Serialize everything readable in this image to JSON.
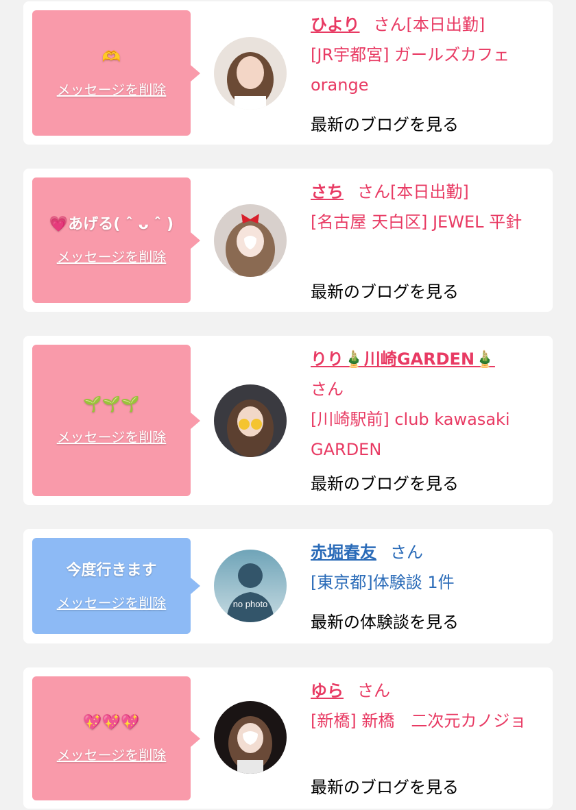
{
  "cards": [
    {
      "message": "🫶",
      "delete_label": "メッセージを削除",
      "name": "ひより",
      "honorific": "さん",
      "status": "[本日出勤]",
      "shop": "[JR宇都宮] ガールズカフェorange",
      "link_label": "最新のブログを見る",
      "avatar_icon": "photo-girl-1"
    },
    {
      "message": "💗あげる( ˆ ᴗ ˆ )",
      "delete_label": "メッセージを削除",
      "name": "さち",
      "honorific": "さん",
      "status": "[本日出勤]",
      "shop": "[名古屋 天白区] JEWEL 平針",
      "link_label": "最新のブログを見る",
      "avatar_icon": "photo-girl-2"
    },
    {
      "message": "🌱🌱🌱",
      "delete_label": "メッセージを削除",
      "name": "りり🎍川崎GARDEN🎍",
      "honorific": "さん",
      "shop": "[川崎駅前] club kawasaki GARDEN",
      "link_label": "最新のブログを見る",
      "avatar_icon": "photo-girl-3"
    },
    {
      "message": "今度行きます",
      "delete_label": "メッセージを削除",
      "name": "赤堀春友",
      "honorific": "さん",
      "shop": "[東京都]体験談 1件",
      "link_label": "最新の体験談を見る",
      "avatar_text": "no photo",
      "avatar_icon": "no-photo-silhouette"
    },
    {
      "message": "💖💖💖",
      "delete_label": "メッセージを削除",
      "name": "ゆら",
      "honorific": "さん",
      "shop": "[新橋] 新橋　二次元カノジョ",
      "link_label": "最新のブログを見る",
      "avatar_icon": "photo-girl-4"
    }
  ],
  "colors": {
    "pink_bubble": "#f99aaa",
    "blue_bubble": "#8dbaf5",
    "pink_text": "#e83a63",
    "blue_text": "#2a6bb8",
    "link_gray": "#9a9a9a"
  }
}
